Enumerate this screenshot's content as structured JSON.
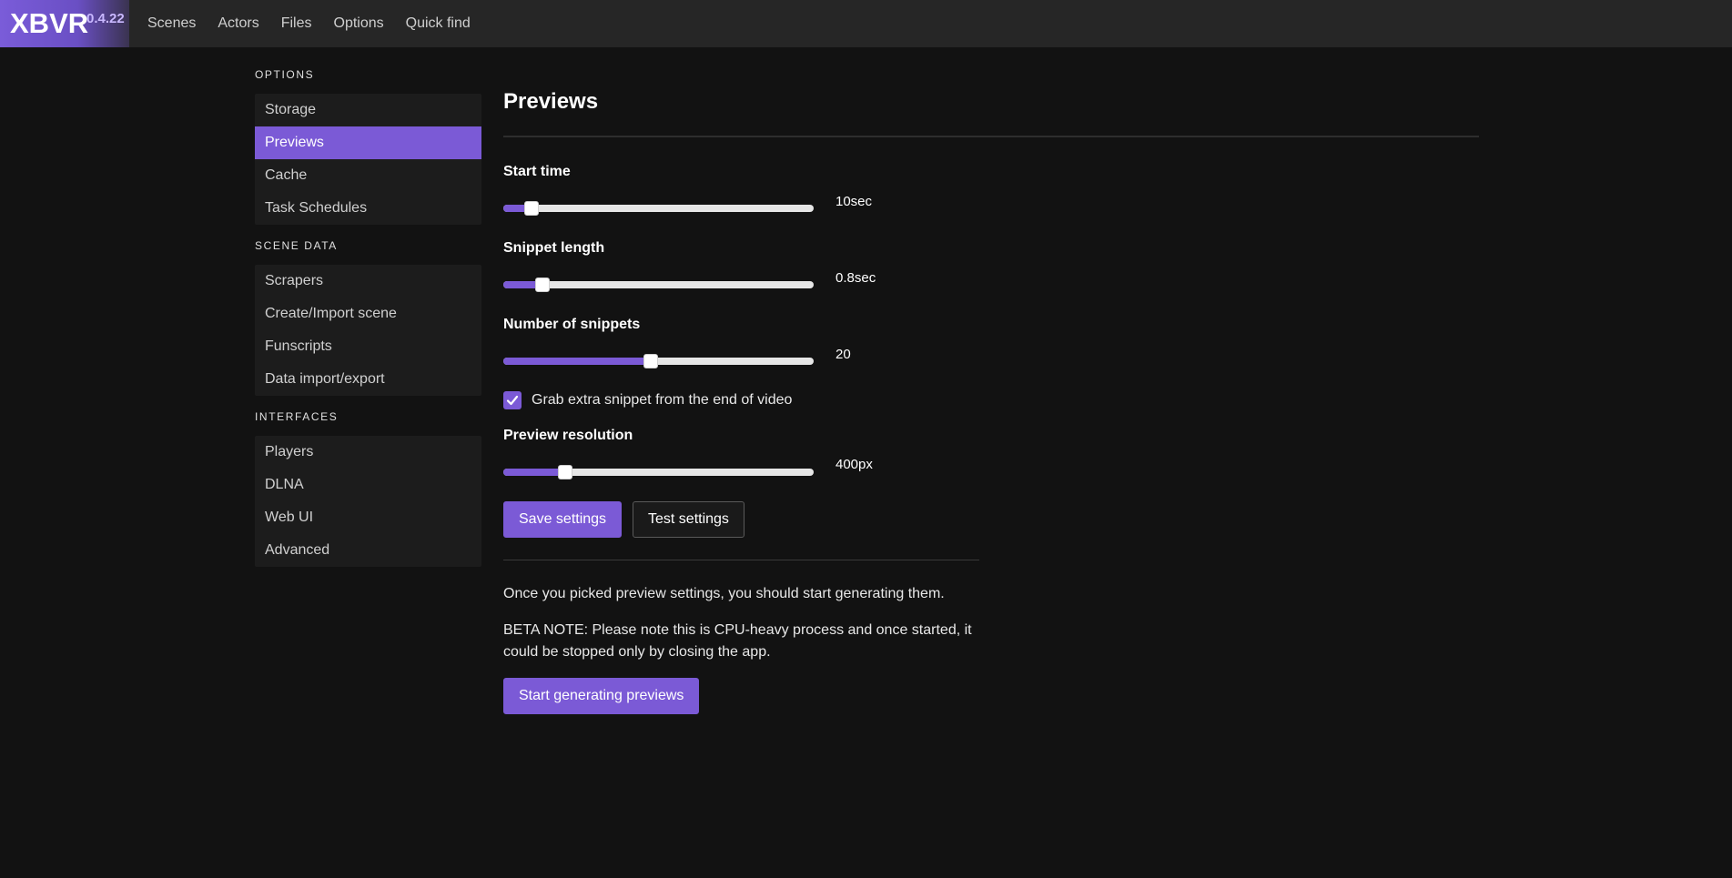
{
  "brand": {
    "name": "XBVR",
    "version": "0.4.22"
  },
  "nav": {
    "items": [
      {
        "label": "Scenes"
      },
      {
        "label": "Actors"
      },
      {
        "label": "Files"
      },
      {
        "label": "Options"
      },
      {
        "label": "Quick find"
      }
    ]
  },
  "sidebar": {
    "sections": [
      {
        "label": "Options",
        "items": [
          {
            "label": "Storage",
            "active": false
          },
          {
            "label": "Previews",
            "active": true
          },
          {
            "label": "Cache",
            "active": false
          },
          {
            "label": "Task Schedules",
            "active": false
          }
        ]
      },
      {
        "label": "Scene data",
        "items": [
          {
            "label": "Scrapers",
            "active": false
          },
          {
            "label": "Create/Import scene",
            "active": false
          },
          {
            "label": "Funscripts",
            "active": false
          },
          {
            "label": "Data import/export",
            "active": false
          }
        ]
      },
      {
        "label": "Interfaces",
        "items": [
          {
            "label": "Players",
            "active": false
          },
          {
            "label": "DLNA",
            "active": false
          },
          {
            "label": "Web UI",
            "active": false
          },
          {
            "label": "Advanced",
            "active": false
          }
        ]
      }
    ]
  },
  "main": {
    "title": "Previews",
    "start_time": {
      "label": "Start time",
      "value_text": "10sec",
      "fraction": 0.09
    },
    "snippet_length": {
      "label": "Snippet length",
      "value_text": "0.8sec",
      "fraction": 0.125
    },
    "number_of_snippets": {
      "label": "Number of snippets",
      "value_text": "20",
      "fraction": 0.475
    },
    "grab_extra": {
      "label": "Grab extra snippet from the end of video",
      "checked": true
    },
    "preview_resolution": {
      "label": "Preview resolution",
      "value_text": "400px",
      "fraction": 0.2
    },
    "save_label": "Save settings",
    "test_label": "Test settings",
    "info_text": "Once you picked preview settings, you should start generating them.",
    "beta_line1": "BETA NOTE: Please note this is CPU-heavy process and once started, it",
    "beta_line2": "could be stopped only by closing the app.",
    "generate_label": "Start generating previews"
  },
  "colors": {
    "accent": "#7b5ad6",
    "background": "#121212",
    "navbar": "#262626",
    "sidebar_panel": "#1c1c1c"
  }
}
